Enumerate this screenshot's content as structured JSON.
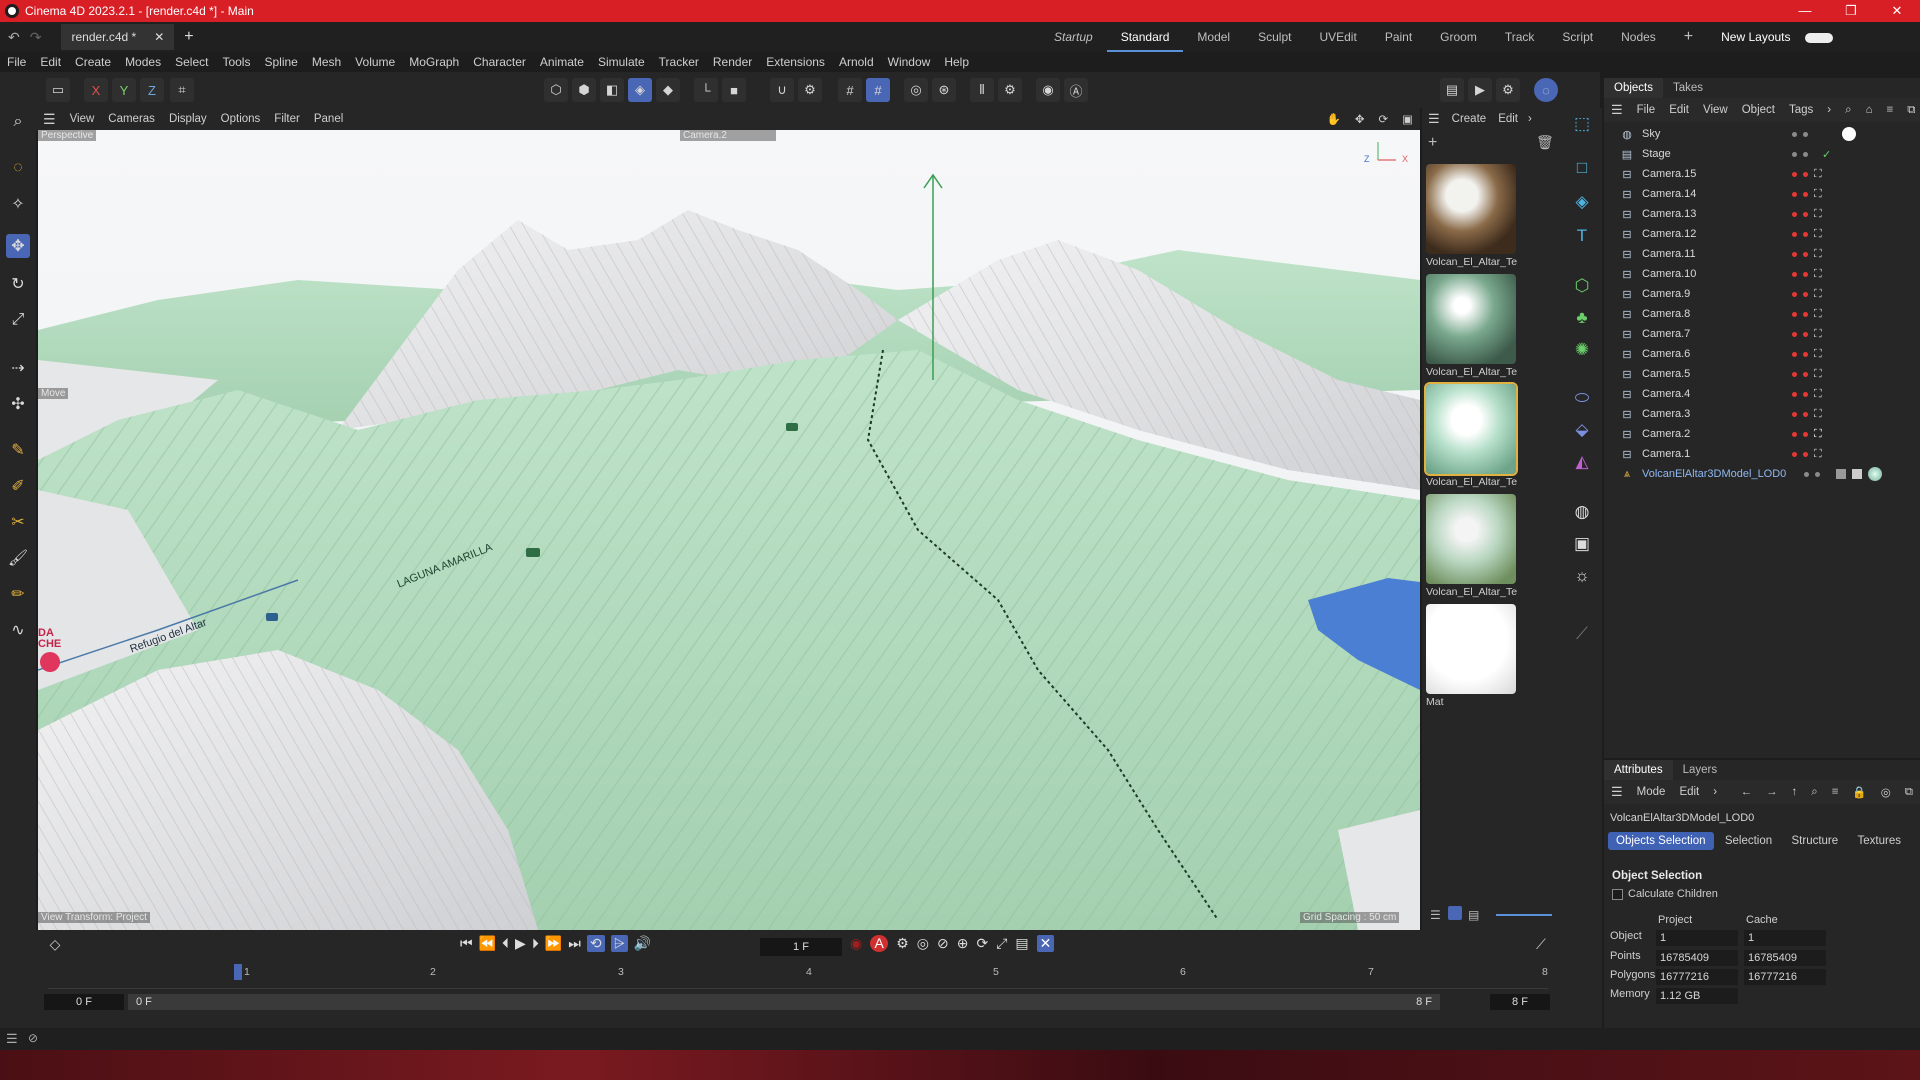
{
  "window": {
    "title": "Cinema 4D 2023.2.1 - [render.c4d *] - Main",
    "controls": [
      "—",
      "❐",
      "✕"
    ]
  },
  "tabs": {
    "doc_tab": "render.c4d *",
    "close": "✕",
    "add": "+",
    "layouts": [
      "Startup",
      "Standard",
      "Model",
      "Sculpt",
      "UVEdit",
      "Paint",
      "Groom",
      "Track",
      "Script",
      "Nodes"
    ],
    "active_layout": "Standard",
    "new_layouts": "New Layouts"
  },
  "menu": [
    "File",
    "Edit",
    "Create",
    "Modes",
    "Select",
    "Tools",
    "Spline",
    "Mesh",
    "Volume",
    "MoGraph",
    "Character",
    "Animate",
    "Simulate",
    "Tracker",
    "Render",
    "Extensions",
    "Arnold",
    "Window",
    "Help"
  ],
  "toolbar": {
    "axes": [
      "X",
      "Y",
      "Z"
    ]
  },
  "viewport_menu": [
    "View",
    "Cameras",
    "Display",
    "Options",
    "Filter",
    "Panel"
  ],
  "viewport": {
    "perspective_label": "Perspective",
    "camera_label": "Camera.2",
    "move_label": "Move",
    "view_transform": "View Transform: Project",
    "grid_spacing": "Grid Spacing : 50 cm",
    "terrain_label_1": "LAGUNA AMARILLA",
    "terrain_label_2": "Refugio del Altar",
    "terrain_label_3": "DA CHE",
    "axis_z": "Z",
    "axis_x": "X"
  },
  "materials": {
    "menu": [
      "Create",
      "Edit"
    ],
    "items": [
      {
        "name": "Volcan_El_Altar_Te"
      },
      {
        "name": "Volcan_El_Altar_Te"
      },
      {
        "name": "Volcan_El_Altar_Te"
      },
      {
        "name": "Volcan_El_Altar_Te"
      },
      {
        "name": "Mat"
      }
    ]
  },
  "objects_panel": {
    "tabs": [
      "Objects",
      "Takes"
    ],
    "menu": [
      "File",
      "Edit",
      "View",
      "Object",
      "Tags"
    ],
    "items": [
      {
        "name": "Sky"
      },
      {
        "name": "Stage"
      },
      {
        "name": "Camera.15"
      },
      {
        "name": "Camera.14"
      },
      {
        "name": "Camera.13"
      },
      {
        "name": "Camera.12"
      },
      {
        "name": "Camera.11"
      },
      {
        "name": "Camera.10"
      },
      {
        "name": "Camera.9"
      },
      {
        "name": "Camera.8"
      },
      {
        "name": "Camera.7"
      },
      {
        "name": "Camera.6"
      },
      {
        "name": "Camera.5"
      },
      {
        "name": "Camera.4"
      },
      {
        "name": "Camera.3"
      },
      {
        "name": "Camera.2"
      },
      {
        "name": "Camera.1"
      },
      {
        "name": "VolcanElAltar3DModel_LOD0"
      }
    ]
  },
  "attributes": {
    "tabs": [
      "Attributes",
      "Layers"
    ],
    "menu": [
      "Mode",
      "Edit"
    ],
    "object_name": "VolcanElAltar3DModel_LOD0",
    "subtabs": [
      "Objects Selection",
      "Selection",
      "Structure",
      "Textures"
    ],
    "section": "Object Selection",
    "calc_children": "Calculate Children",
    "col_project": "Project",
    "col_cache": "Cache",
    "rows": [
      {
        "label": "Object",
        "project": "1",
        "cache": "1"
      },
      {
        "label": "Points",
        "project": "16785409",
        "cache": "16785409"
      },
      {
        "label": "Polygons",
        "project": "16777216",
        "cache": "16777216"
      },
      {
        "label": "Memory",
        "project": "1.12 GB",
        "cache": ""
      }
    ]
  },
  "timeline": {
    "frame_field": "1 F",
    "ticks": [
      "1",
      "2",
      "3",
      "4",
      "5",
      "6",
      "7",
      "8"
    ],
    "start": "0 F",
    "start2": "0 F",
    "end": "8 F",
    "end2": "8 F"
  },
  "colors": {
    "accent": "#4a67b6",
    "title_bar": "#d81f26",
    "terrain_green": "#a8d5b5",
    "terrain_white": "#e8e8ea"
  }
}
